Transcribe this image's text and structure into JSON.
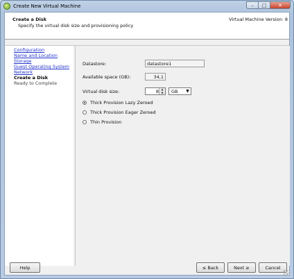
{
  "window": {
    "title": "Create New Virtual Machine"
  },
  "header": {
    "title": "Create a Disk",
    "subtitle": "Specify the virtual disk size and provisioning policy",
    "version": "Virtual Machine Version: 8"
  },
  "steps": [
    {
      "label": "Configuration",
      "state": "link"
    },
    {
      "label": "Name and Location",
      "state": "link"
    },
    {
      "label": "Storage",
      "state": "link"
    },
    {
      "label": "Guest Operating System",
      "state": "link"
    },
    {
      "label": "Network",
      "state": "link"
    },
    {
      "label": "Create a Disk",
      "state": "current"
    },
    {
      "label": "Ready to Complete",
      "state": "future"
    }
  ],
  "form": {
    "datastore_label": "Datastore:",
    "datastore_value": "datastore1",
    "available_label": "Available space (GB):",
    "available_value": "34,1",
    "size_label": "Virtual disk size:",
    "size_value": "8",
    "size_unit": "GB",
    "provisioning": [
      {
        "label": "Thick Provision Lazy Zeroed",
        "selected": true
      },
      {
        "label": "Thick Provision Eager Zeroed",
        "selected": false
      },
      {
        "label": "Thin Provision",
        "selected": false
      }
    ]
  },
  "buttons": {
    "help": "Help",
    "back": "≤ Back",
    "next": "Next ≥",
    "cancel": "Cancel"
  }
}
